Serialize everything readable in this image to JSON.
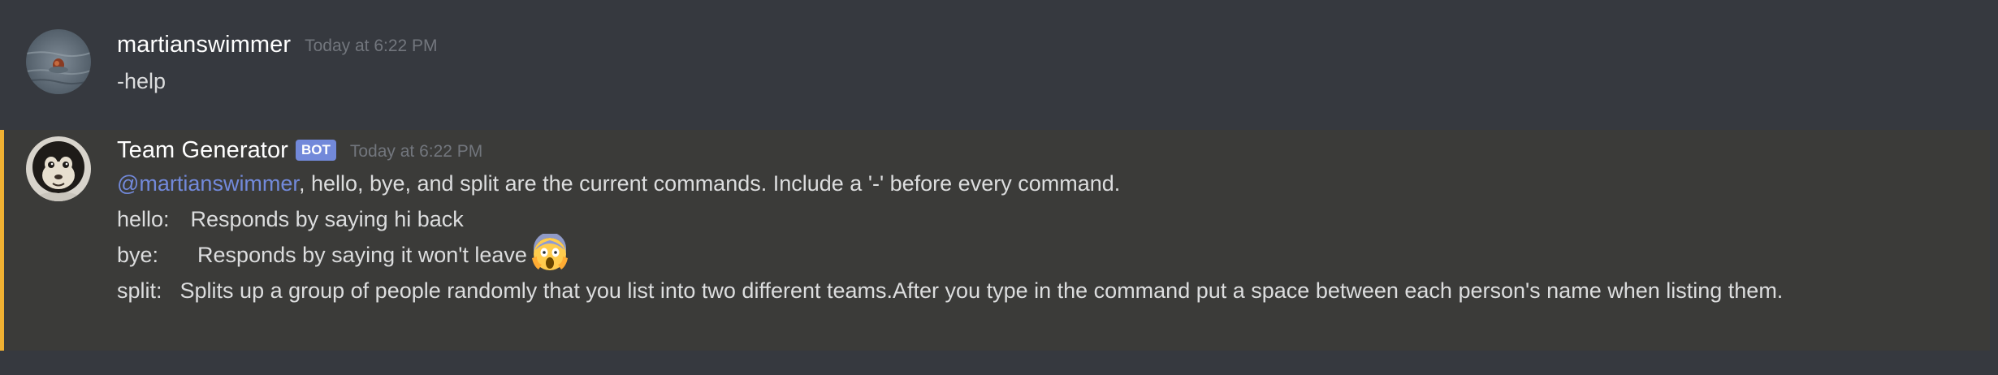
{
  "messages": [
    {
      "username": "martianswimmer",
      "timestamp": "Today at 6:22 PM",
      "text": "-help"
    },
    {
      "username": "Team Generator",
      "badge": "BOT",
      "timestamp": "Today at 6:22 PM",
      "mention": "@martianswimmer",
      "intro": ", hello, bye, and split are the current commands. Include a '-' before every command.",
      "commands": [
        {
          "name": "hello:",
          "desc": "Responds by saying hi back"
        },
        {
          "name": "bye:",
          "desc": "Responds by saying it won't leave",
          "emoji": "face-screaming-in-fear-icon"
        },
        {
          "name": "split:",
          "desc": "Splits up a group of people randomly that you list into two different teams.After you type in the command put a space between each person's name when listing them."
        }
      ]
    }
  ],
  "colors": {
    "background": "#36393f",
    "highlight_background": "#3b3b39",
    "mention_bar": "#f0b132",
    "mention_text": "#7289da",
    "bot_badge": "#7289da",
    "username": "#ffffff",
    "timestamp": "#72767d",
    "message_text": "#dcddde"
  }
}
